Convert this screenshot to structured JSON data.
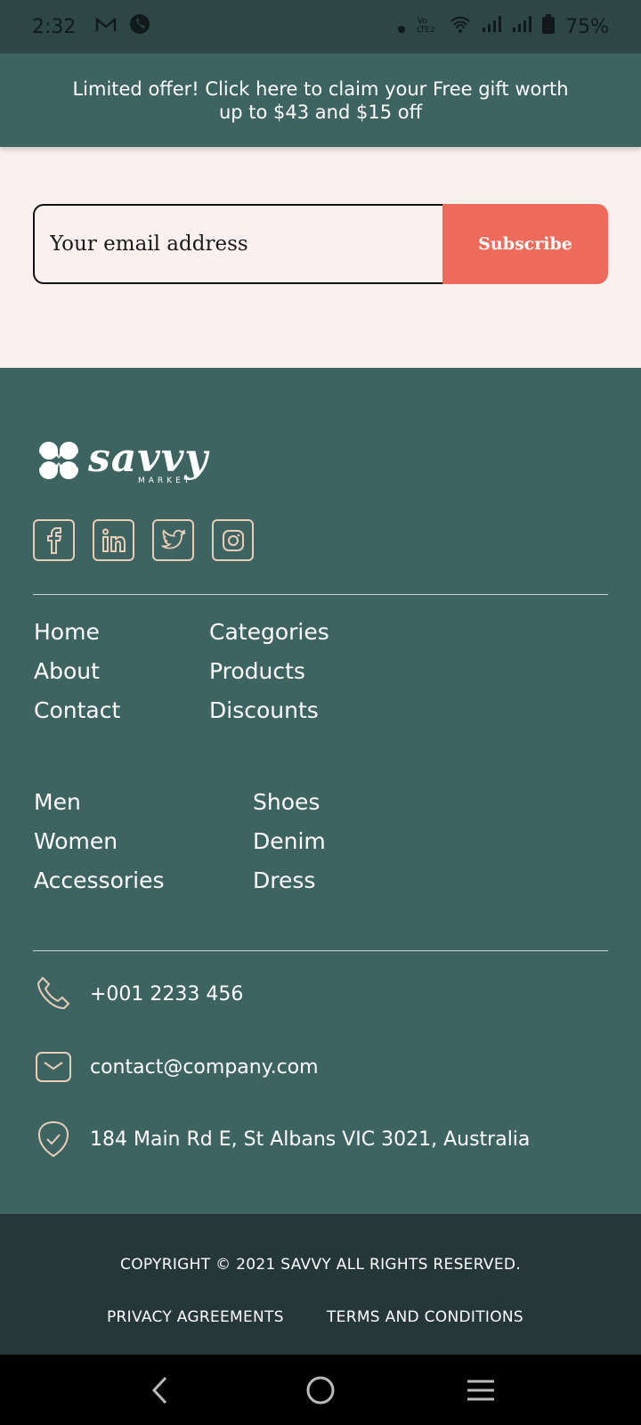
{
  "status_bar": {
    "time": "2:32",
    "battery": "75%",
    "left_icons": [
      "gmail-icon",
      "phone-icon"
    ],
    "right_icons": [
      "dot-icon",
      "volte-icon",
      "wifi-icon",
      "signal-icon",
      "signal-icon",
      "battery-icon"
    ]
  },
  "banner": {
    "line1": "Limited offer! Click here to claim your Free gift worth",
    "line2": "up to $43 and $15 off"
  },
  "newsletter": {
    "email_placeholder": "Your email address",
    "subscribe_label": "Subscribe"
  },
  "footer": {
    "logo": {
      "word": "savvy",
      "sub": "MARKET"
    },
    "socials": [
      "facebook-icon",
      "linkedin-icon",
      "twitter-icon",
      "instagram-icon"
    ],
    "nav_col1": [
      "Home",
      "About",
      "Contact"
    ],
    "nav_col2": [
      "Categories",
      "Products",
      "Discounts"
    ],
    "shop_col1": [
      "Men",
      "Women",
      "Accessories"
    ],
    "shop_col2": [
      "Shoes",
      "Denim",
      "Dress"
    ],
    "contact": {
      "phone": "+001 2233 456",
      "email": "contact@company.com",
      "address": "184 Main Rd E, St Albans VIC 3021, Australia"
    }
  },
  "bottom": {
    "copyright": "COPYRIGHT © 2021 SAVVY ALL RIGHTS RESERVED.",
    "privacy": "PRIVACY AGREEMENTS",
    "terms": "TERMS AND CONDITIONS"
  },
  "colors": {
    "teal": "#3d6461",
    "dark_teal": "#253738",
    "accent_coral": "#ee6b5c",
    "cream": "#faf1ef",
    "icon_tan": "#e9cdb8"
  }
}
